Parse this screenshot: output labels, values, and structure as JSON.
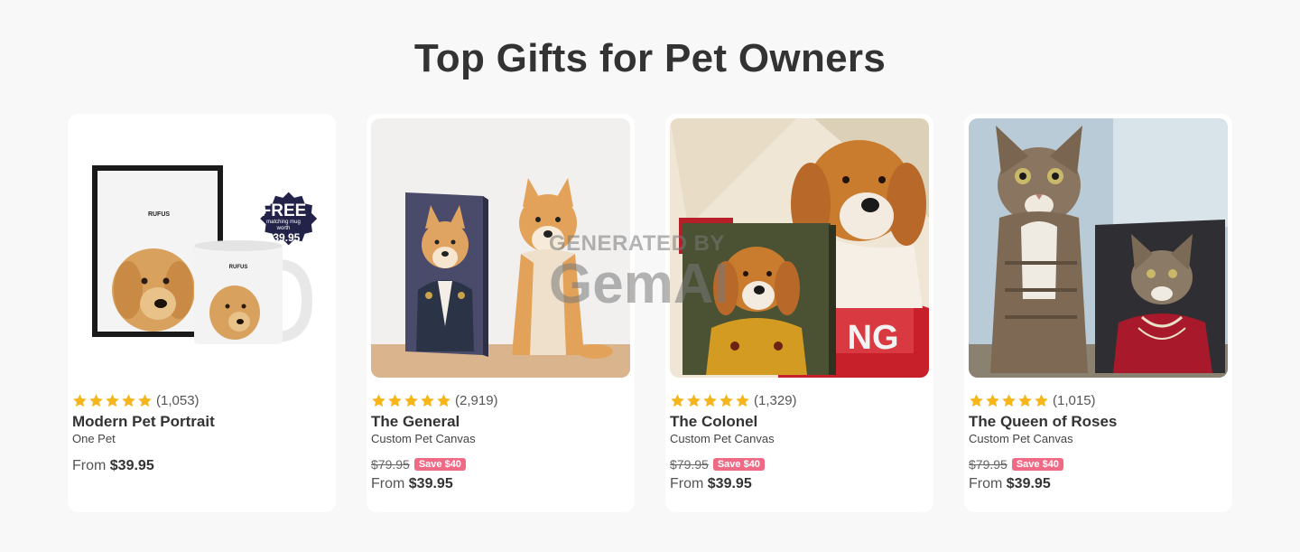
{
  "section": {
    "title": "Top Gifts for Pet Owners"
  },
  "watermark": {
    "line1": "GENERATED BY",
    "line2": "GemAI"
  },
  "colors": {
    "star": "#f5b51d",
    "save_badge": "#f06a86",
    "text": "#333333",
    "background": "#f8f8f8"
  },
  "products": [
    {
      "image_icon": "pet-portrait-mug-image",
      "frame_label": "RUFUS",
      "mug_label": "RUFUS",
      "promo_badge": {
        "big": "FREE",
        "small1": "matching mug",
        "small2": "worth",
        "price": "$39.95"
      },
      "rating": 5,
      "reviews": "(1,053)",
      "name": "Modern Pet Portrait",
      "subtitle": "One Pet",
      "old_price": "",
      "save": "",
      "from_label": "From",
      "price": "$39.95"
    },
    {
      "image_icon": "shiba-general-canvas-image",
      "rating": 5,
      "reviews": "(2,919)",
      "name": "The General",
      "subtitle": "Custom Pet Canvas",
      "old_price": "$79.95",
      "save": "Save $40",
      "from_label": "From",
      "price": "$39.95"
    },
    {
      "image_icon": "retriever-colonel-canvas-image",
      "rating": 5,
      "reviews": "(1,329)",
      "name": "The Colonel",
      "subtitle": "Custom Pet Canvas",
      "old_price": "$79.95",
      "save": "Save $40",
      "from_label": "From",
      "price": "$39.95"
    },
    {
      "image_icon": "cat-queen-canvas-image",
      "rating": 5,
      "reviews": "(1,015)",
      "name": "The Queen of Roses",
      "subtitle": "Custom Pet Canvas",
      "old_price": "$79.95",
      "save": "Save $40",
      "from_label": "From",
      "price": "$39.95"
    }
  ]
}
